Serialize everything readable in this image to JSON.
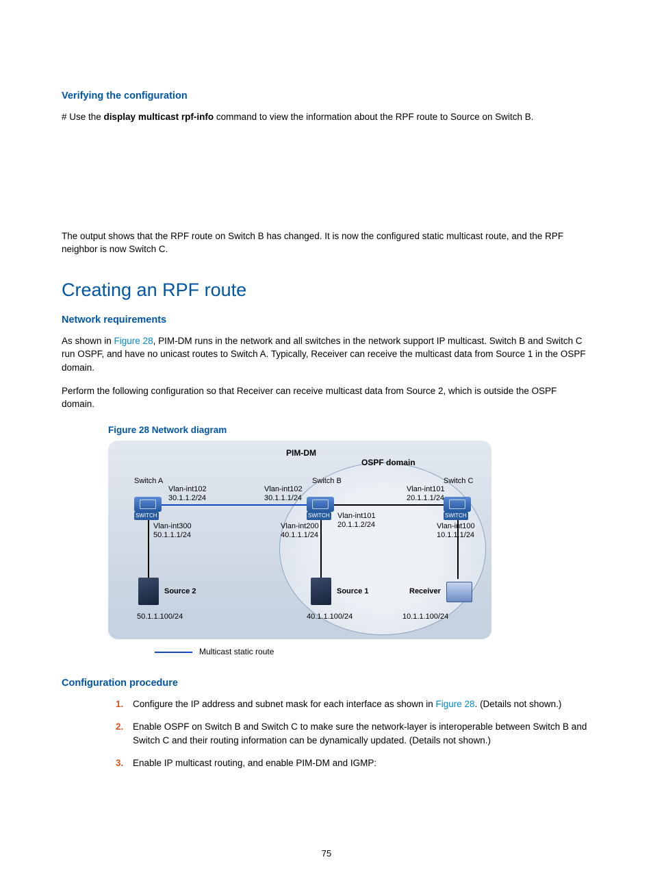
{
  "section1": {
    "heading": "Verifying the configuration",
    "para1_prefix": "# Use the ",
    "para1_cmd": "display multicast rpf-info",
    "para1_suffix": " command to view the information about the RPF route to Source on Switch B.",
    "para2": "The output shows that the RPF route on Switch B has changed. It is now the configured static multicast route, and the RPF neighbor is now Switch C."
  },
  "h2": "Creating an RPF route",
  "network_req": {
    "heading": "Network requirements",
    "p1_a": "As shown in ",
    "p1_link": "Figure 28",
    "p1_b": ", PIM-DM runs in the network and all switches in the network support IP multicast. Switch B and Switch C run OSPF, and have no unicast routes to Switch A. Typically, Receiver can receive the multicast data from Source 1 in the OSPF domain.",
    "p2": "Perform the following configuration so that Receiver can receive multicast data from Source 2, which is outside the OSPF domain."
  },
  "figure": {
    "caption": "Figure 28 Network diagram",
    "pim_dm": "PIM-DM",
    "ospf_domain": "OSPF domain",
    "switch_a": "Switch A",
    "switch_b": "Switch B",
    "switch_c": "Switch C",
    "sa": {
      "vlan102": "Vlan-int102",
      "ip102": "30.1.1.2/24",
      "vlan300": "Vlan-int300",
      "ip300": "50.1.1.1/24"
    },
    "sb": {
      "vlan102": "Vlan-int102",
      "ip102": "30.1.1.1/24",
      "vlan200": "Vlan-int200",
      "ip200": "40.1.1.1/24",
      "vlan101": "Vlan-int101",
      "ip101": "20.1.1.2/24"
    },
    "sc": {
      "vlan101": "Vlan-int101",
      "ip101": "20.1.1.1/24",
      "vlan100": "Vlan-int100",
      "ip100": "10.1.1.1/24"
    },
    "source2": "Source 2",
    "source2_ip": "50.1.1.100/24",
    "source1": "Source 1",
    "source1_ip": "40.1.1.100/24",
    "receiver": "Receiver",
    "receiver_ip": "10.1.1.100/24",
    "switch_tag": "SWITCH",
    "legend": "Multicast static route"
  },
  "config_proc": {
    "heading": "Configuration procedure",
    "s1a": "Configure the IP address and subnet mask for each interface as shown in ",
    "s1link": "Figure 28",
    "s1b": ". (Details not shown.)",
    "s2": "Enable OSPF on Switch B and Switch C to make sure the network-layer is interoperable between Switch B and Switch C and their routing information can be dynamically updated. (Details not shown.)",
    "s3": "Enable IP multicast routing, and enable PIM-DM and IGMP:"
  },
  "pagenum": "75"
}
